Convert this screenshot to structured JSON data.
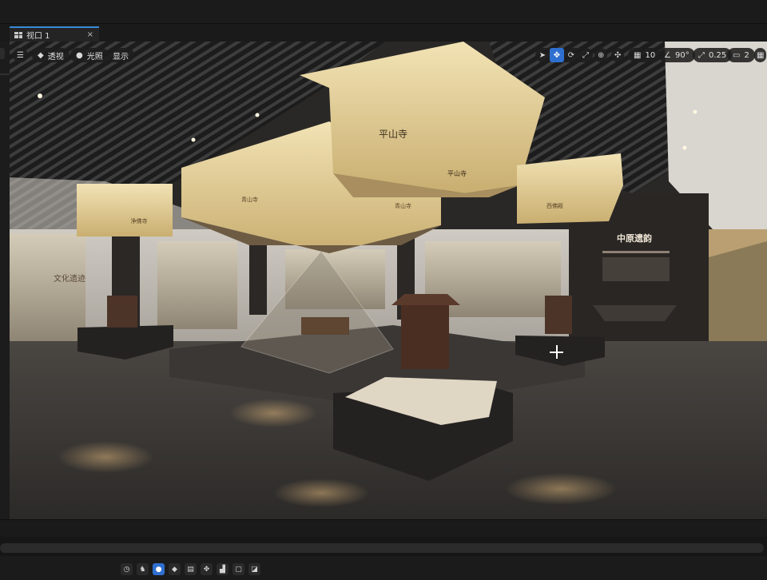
{
  "window": {
    "tab_label": "视口 1",
    "tab_close": "×"
  },
  "viewport_toolbar": {
    "menu_icon": "hamburger-icon",
    "perspective_label": "透视",
    "lighting_label": "光照",
    "show_label": "显示",
    "grid_snap_value": "10",
    "rotation_snap_value": "90°",
    "scale_snap_value": "0.25",
    "camera_speed_value": "2"
  },
  "scene": {
    "hanging_sign_center_front": "平山寺",
    "hanging_sign_center_side": "平山寺",
    "hanging_sign_left": "青山寺",
    "hanging_sign_small_left": "净佛寺",
    "hanging_sign_right": "西佛殿",
    "hanging_sign_center_lower": "青山寺",
    "right_wall_title": "中原遗韵",
    "left_wall_text": "文化遗迹"
  },
  "bottom_toolbar": {
    "icons": [
      "clock-icon",
      "actor-icon",
      "light-icon",
      "mesh-icon",
      "camera-icon",
      "particles-icon",
      "blocks-icon",
      "frame-icon",
      "folder-icon"
    ]
  },
  "colors": {
    "accent": "#2f6fd0",
    "panel_dark": "#1b1b1b",
    "sign_gold": "#e6d29b"
  }
}
